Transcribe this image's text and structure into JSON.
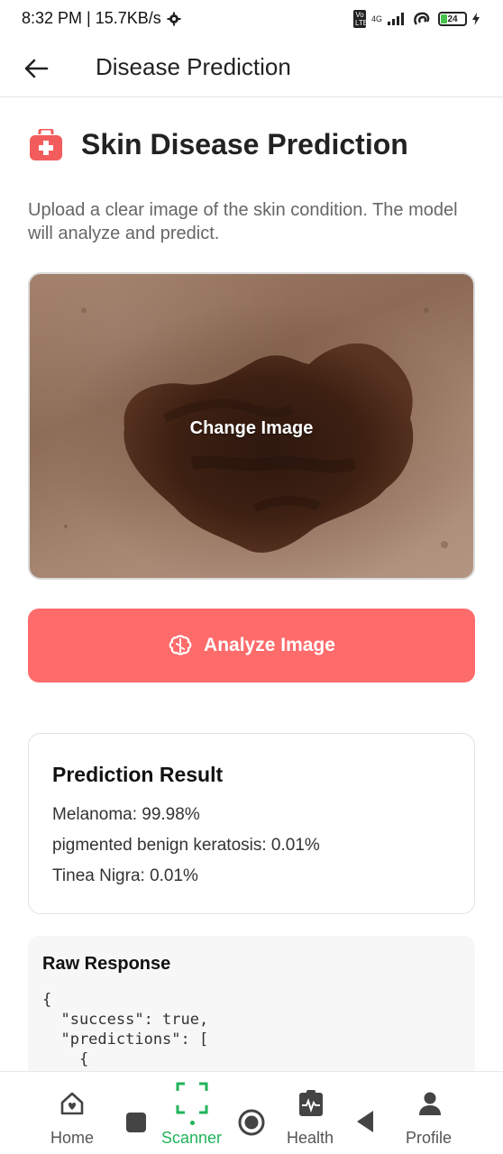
{
  "status_bar": {
    "time_speed": "8:32 PM | 15.7KB/s",
    "network": "4G",
    "battery": "24"
  },
  "app_bar": {
    "title": "Disease Prediction"
  },
  "page": {
    "heading": "Skin Disease Prediction",
    "description": "Upload a clear image of the skin condition. The model will analyze and predict.",
    "image_overlay_label": "Change Image",
    "analyze_button": "Analyze Image"
  },
  "result": {
    "title": "Prediction Result",
    "items": [
      "Melanoma: 99.98%",
      "pigmented benign keratosis: 0.01%",
      "Tinea Nigra: 0.01%"
    ]
  },
  "raw_response": {
    "title": "Raw Response",
    "code": "{\n  \"success\": true,\n  \"predictions\": [\n    {"
  },
  "bottom_nav": {
    "items": [
      {
        "label": "Home",
        "icon": "home-icon"
      },
      {
        "label": "Scanner",
        "icon": "scanner-icon"
      },
      {
        "label": "Health",
        "icon": "health-icon"
      },
      {
        "label": "Profile",
        "icon": "profile-icon"
      }
    ],
    "active": "Scanner"
  },
  "colors": {
    "accent": "#fe6b6b",
    "active_nav": "#22b35a"
  }
}
